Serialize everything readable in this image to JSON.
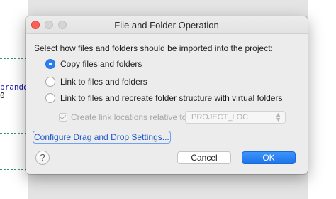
{
  "background": {
    "code_lines": [
      "brando",
      "0"
    ]
  },
  "dialog": {
    "title": "File and Folder Operation",
    "instruction": "Select how files and folders should be imported into the project:",
    "options": [
      {
        "label": "Copy files and folders",
        "checked": true
      },
      {
        "label": "Link to files and folders",
        "checked": false
      },
      {
        "label": "Link to files and recreate folder structure with virtual folders",
        "checked": false
      }
    ],
    "link_locations": {
      "label": "Create link locations relative to:",
      "checked": true,
      "enabled": false,
      "select_value": "PROJECT_LOC"
    },
    "configure_link": "Configure Drag and Drop Settings...",
    "help_icon": "?",
    "buttons": {
      "cancel": "Cancel",
      "ok": "OK"
    }
  },
  "colors": {
    "accent": "#2b7ff5",
    "close": "#fe5f57",
    "link": "#1b55c8"
  }
}
